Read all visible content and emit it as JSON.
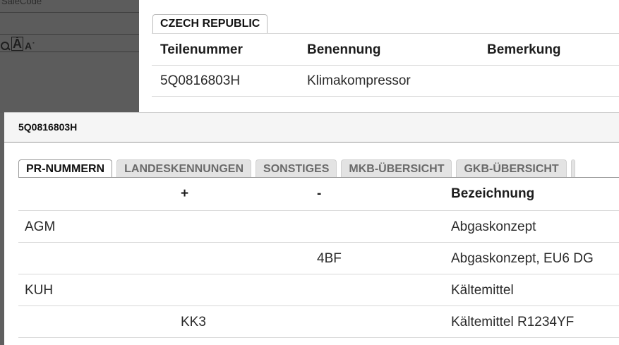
{
  "sidebar": {
    "salecode_label": "SaleCode"
  },
  "part_table": {
    "country_tab": "CZECH REPUBLIC",
    "headers": [
      "Teilenummer",
      "Benennung",
      "Bemerkung"
    ],
    "row": [
      "5Q0816803H",
      "Klimakompressor",
      ""
    ]
  },
  "dialog": {
    "title": "5Q0816803H",
    "tabs": [
      "PR-NUMMERN",
      "LANDESKENNUNGEN",
      "SONSTIGES",
      "MKB-ÜBERSICHT",
      "GKB-ÜBERSICHT"
    ],
    "active_tab": "PR-NUMMERN",
    "table": {
      "headers": [
        "",
        "+",
        "-",
        "Bezeichnung"
      ],
      "rows": [
        [
          "AGM",
          "",
          "",
          "Abgaskonzept"
        ],
        [
          "",
          "",
          "4BF",
          "Abgaskonzept, EU6 DG"
        ],
        [
          "KUH",
          "",
          "",
          "Kältemittel"
        ],
        [
          "",
          "KK3",
          "",
          "Kältemittel R1234YF"
        ]
      ]
    }
  }
}
